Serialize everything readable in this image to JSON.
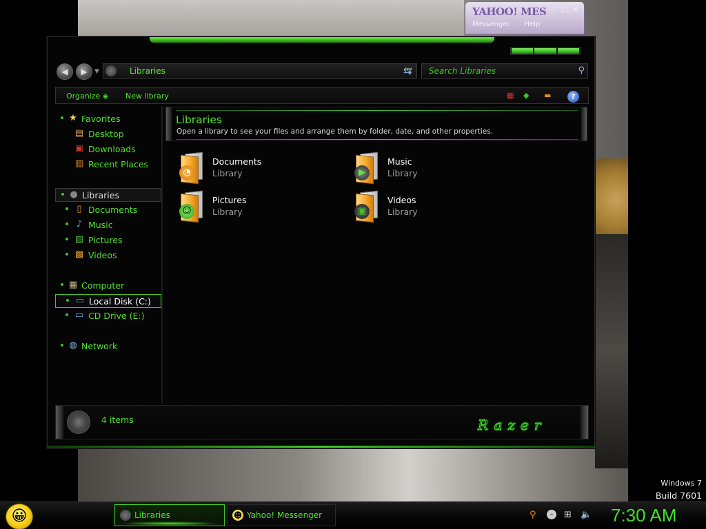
{
  "yahoo_window": {
    "title": "YAHOO! MES",
    "menu": [
      "Messenger",
      "Help"
    ]
  },
  "explorer": {
    "address": "Libraries",
    "search_placeholder": "Search Libraries",
    "toolbar": {
      "organize": "Organize",
      "new_library": "New library"
    },
    "nav": {
      "favorites": {
        "label": "Favorites",
        "icon": "star-icon"
      },
      "favorites_items": [
        {
          "label": "Desktop",
          "icon": "desktop-icon"
        },
        {
          "label": "Downloads",
          "icon": "downloads-icon"
        },
        {
          "label": "Recent Places",
          "icon": "recent-places-icon"
        }
      ],
      "libraries": {
        "label": "Libraries",
        "icon": "libraries-icon"
      },
      "libraries_items": [
        {
          "label": "Documents",
          "icon": "documents-icon"
        },
        {
          "label": "Music",
          "icon": "music-icon"
        },
        {
          "label": "Pictures",
          "icon": "pictures-icon"
        },
        {
          "label": "Videos",
          "icon": "videos-icon"
        }
      ],
      "computer": {
        "label": "Computer",
        "icon": "computer-icon"
      },
      "computer_items": [
        {
          "label": "Local Disk (C:)",
          "icon": "disk-icon"
        },
        {
          "label": "CD Drive (E:)",
          "icon": "cd-drive-icon"
        }
      ],
      "network": {
        "label": "Network",
        "icon": "network-icon"
      }
    },
    "header": {
      "title": "Libraries",
      "description": "Open a library to see your files and arrange them by folder, date, and other properties."
    },
    "libraries": [
      {
        "name": "Documents",
        "type": "Library",
        "icon": "documents-library-icon"
      },
      {
        "name": "Music",
        "type": "Library",
        "icon": "music-library-icon"
      },
      {
        "name": "Pictures",
        "type": "Library",
        "icon": "pictures-library-icon"
      },
      {
        "name": "Videos",
        "type": "Library",
        "icon": "videos-library-icon"
      }
    ],
    "status": {
      "item_count": "4 items",
      "brand_logo": "Razer"
    }
  },
  "taskbar": {
    "tasks": [
      {
        "label": "Libraries",
        "active": true
      },
      {
        "label": "Yahoo! Messenger",
        "active": false
      }
    ],
    "clock": "7:30 AM"
  },
  "watermark": {
    "os": "Windows 7",
    "build": "Build 7601"
  },
  "colors": {
    "accent": "#4fe030",
    "background": "#050505"
  }
}
